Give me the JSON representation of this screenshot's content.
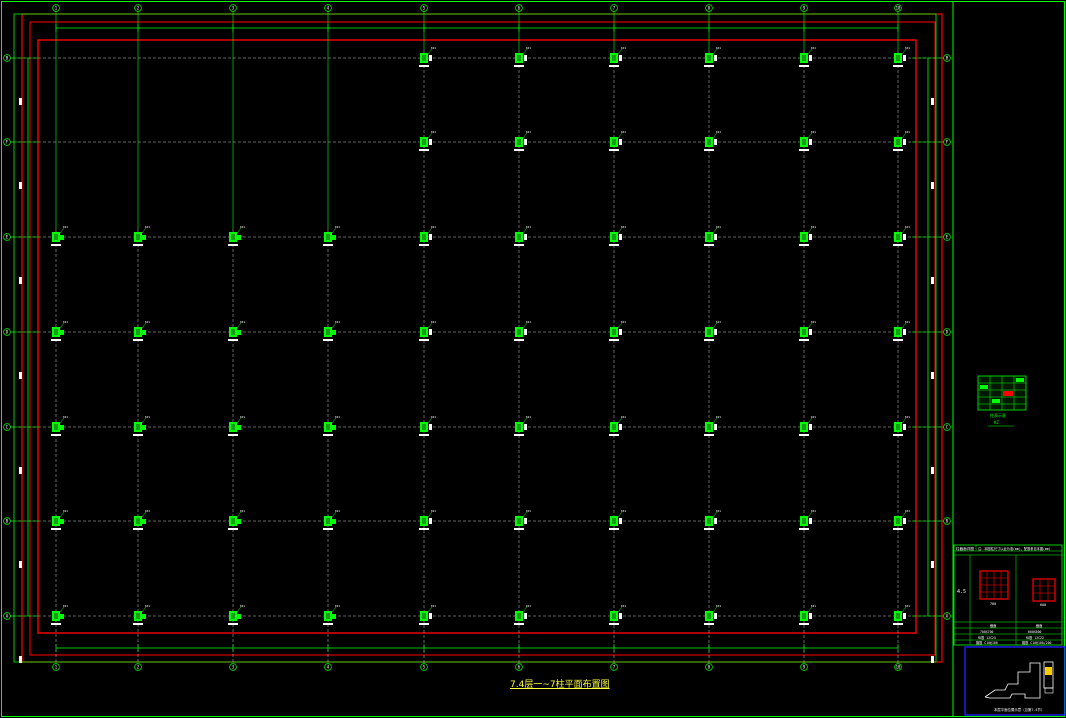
{
  "drawing": {
    "title": "7.4层一~7柱平面布置图",
    "grid_columns": [
      "1",
      "2",
      "3",
      "4",
      "5",
      "6",
      "7",
      "8",
      "9",
      "10"
    ],
    "grid_rows": [
      "B",
      "F",
      "E",
      "D",
      "C",
      "B",
      "A"
    ],
    "column_label": "KZ1",
    "colors": {
      "background": "#000000",
      "border": "#00ff00",
      "outline": "#ff0000",
      "gridline": "#c8c8c8",
      "column_fill": "#00ff00",
      "title": "#ffff3c",
      "note_box": "#0000ff"
    }
  },
  "legend_table": {
    "label": "柱表示意",
    "note": "KZ"
  },
  "detail_table": {
    "header_left": "柱截面详图",
    "header_right": "注：本图柱尺寸以此为准(mm)，配筋参见本图(mm)",
    "row_label": "4.5",
    "rows": [
      [
        "截面",
        "截面"
      ],
      [
        "700X700",
        "600X600"
      ],
      [
        "纵筋 12C25",
        "纵筋 12C22"
      ],
      [
        "箍筋 C10@100",
        "箍筋 C10@100/200"
      ]
    ],
    "dimensions": [
      "700",
      "600"
    ]
  },
  "key_plan": {
    "caption": "本层平面位置示意（见第7.4节）"
  }
}
